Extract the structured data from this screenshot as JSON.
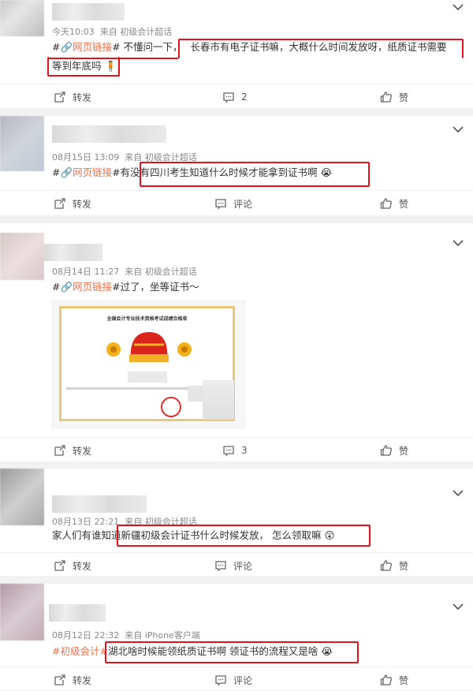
{
  "posts": [
    {
      "time": "今天10:03",
      "source": "来自 初级会计超话",
      "tag_prefix": "#",
      "link_label": "网页链接",
      "pre_text": "# 不懂问一下",
      "line1": "长春市有电子证书嘛，大概什么时间发放呀，纸质证书需要",
      "line2": "等到年底吗",
      "repost": "转发",
      "comment": "2",
      "like": "赞"
    },
    {
      "time": "08月15日 13:09",
      "source": "来自 初级会计超话",
      "tag_prefix": "#",
      "link_label": "网页链接",
      "pre_text": "#有没有",
      "highlight": "四川考生知道什么时候才能拿到证书啊",
      "repost": "转发",
      "comment": "评论",
      "like": "赞"
    },
    {
      "time": "08月14日 11:27",
      "source": "来自 初级会计超话",
      "tag_prefix": "#",
      "link_label": "网页链接",
      "post_text": "#过了，坐等证书～",
      "cert_title": "全国会计专业技术资格考试成绩合格单",
      "repost": "转发",
      "comment": "3",
      "like": "赞"
    },
    {
      "time": "08月13日 22:21",
      "source": "来自 初级会计超话",
      "pre_text": "家人们有谁知道",
      "highlight": "新疆初级会计证书什么时候发放， 怎么领取嘛",
      "repost": "转发",
      "comment": "评论",
      "like": "赞"
    },
    {
      "time": "08月12日 22:32",
      "source": "来自 iPhone客户端",
      "tag": "#初级会计#",
      "highlight": "湖北啥时候能领纸质证书啊 领证书的流程又是啥",
      "repost": "转发",
      "comment": "评论",
      "like": "赞"
    }
  ],
  "colors": {
    "tag": "#eb7350",
    "highlight_border": "#e0141e",
    "background": "#f2f2f2"
  }
}
